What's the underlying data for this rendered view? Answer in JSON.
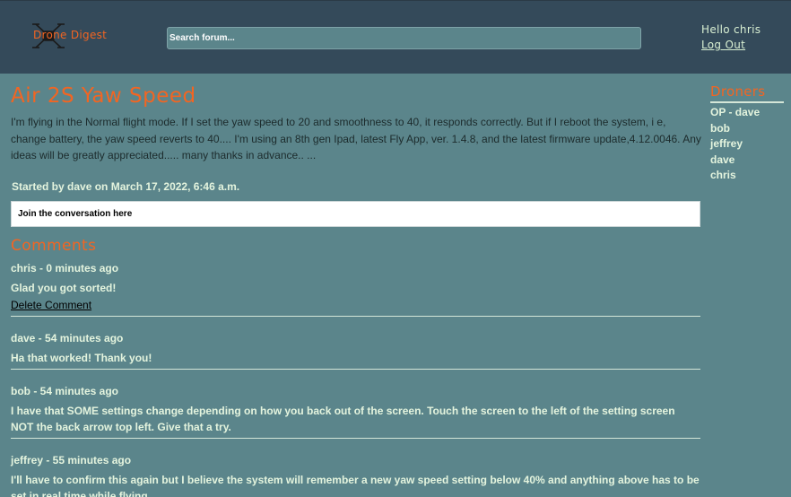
{
  "header": {
    "logo_text": "Drone Digest",
    "search_placeholder": "Search forum...",
    "greeting": "Hello chris",
    "logout_label": "Log Out"
  },
  "post": {
    "title": "Air 2S Yaw Speed",
    "body": "I'm flying in the Normal flight mode. If I set the yaw speed to 20 and smoothness to 40, it responds correctly. But if I reboot the system, i e, change battery, the yaw speed reverts to 40.... I'm using an 8th gen Ipad, latest Fly App, ver. 1.4.8, and the latest firmware update,4.12.0046. Any ideas will be greatly appreciated..... many thanks in advance.. ...",
    "started_by": "Started by dave on March 17, 2022, 6:46 a.m.",
    "join_placeholder": "Join the conversation here"
  },
  "comments_heading": "Comments",
  "comments": [
    {
      "meta": "chris - 0 minutes ago",
      "text": "Glad you got sorted!",
      "delete_label": "Delete Comment"
    },
    {
      "meta": "dave - 54 minutes ago",
      "text": "Ha that worked! Thank you!"
    },
    {
      "meta": "bob - 54 minutes ago",
      "text": "I have that SOME settings change depending on how you back out of the screen. Touch the screen to the left of the setting screen NOT the back arrow top left. Give that a try."
    },
    {
      "meta": "jeffrey - 55 minutes ago",
      "text": "I'll have to confirm this again but I believe the system will remember a new yaw speed setting below 40% and anything above has to be set in real time while flying."
    }
  ],
  "sidebar": {
    "heading": "Droners",
    "members": [
      "OP - dave",
      "bob",
      "jeffrey",
      "dave",
      "chris"
    ]
  },
  "colors": {
    "header_bg": "#344a5a",
    "page_bg": "#5b858b",
    "accent": "#f26522",
    "text_light": "#e4f4de"
  }
}
